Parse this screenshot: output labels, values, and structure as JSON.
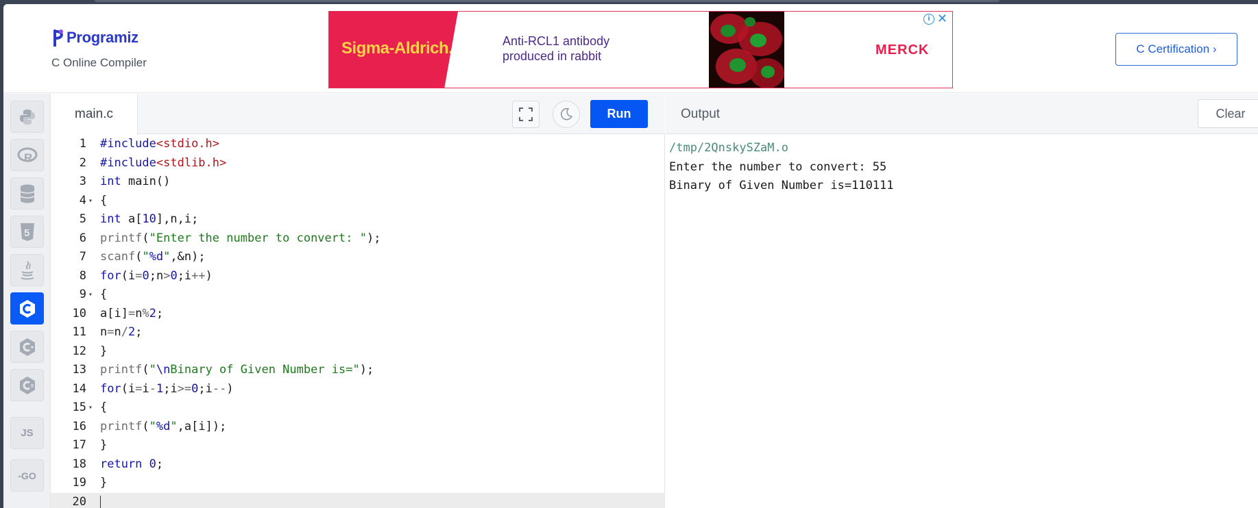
{
  "header": {
    "brand": "Programiz",
    "subtitle": "C Online Compiler",
    "certification_button": "C Certification ›"
  },
  "ad": {
    "advertiser": "Sigma-Aldrich.",
    "line1": "Anti-RCL1 antibody",
    "line2": "produced in rabbit",
    "brand2": "MERCK",
    "info_icon": "info-icon",
    "close_icon": "close-icon",
    "colors": {
      "accent": "#e8204e",
      "text": "#4b2a8a",
      "logo_text": "#ffd24a"
    }
  },
  "sidebar": {
    "languages": [
      {
        "name": "python",
        "label": "",
        "icon": "python-icon"
      },
      {
        "name": "r",
        "label": "R",
        "icon": "r-icon"
      },
      {
        "name": "sql",
        "label": "",
        "icon": "database-icon"
      },
      {
        "name": "html",
        "label": "5",
        "icon": "html5-icon"
      },
      {
        "name": "java",
        "label": "",
        "icon": "java-icon"
      },
      {
        "name": "c",
        "label": "C",
        "icon": "c-icon",
        "active": true
      },
      {
        "name": "cpp",
        "label": "C",
        "icon": "cpp-icon"
      },
      {
        "name": "csharp",
        "label": "C",
        "icon": "csharp-icon"
      },
      {
        "name": "js",
        "label": "JS",
        "icon": "js-icon"
      },
      {
        "name": "go",
        "label": "GO",
        "icon": "go-icon"
      }
    ]
  },
  "editor": {
    "filename": "main.c",
    "run_label": "Run",
    "fullscreen_icon": "fullscreen-icon",
    "theme_icon": "moon-icon",
    "lines": [
      "#include<stdio.h>",
      "#include<stdlib.h>",
      "int main()",
      "{",
      "int a[10],n,i;",
      "printf(\"Enter the number to convert: \");",
      "scanf(\"%d\",&n);",
      "for(i=0;n>0;i++)",
      "{",
      "a[i]=n%2;",
      "n=n/2;",
      "}",
      "printf(\"\\nBinary of Given Number is=\");",
      "for(i=i-1;i>=0;i--)",
      "{",
      "printf(\"%d\",a[i]);",
      "}",
      "return 0;",
      "}",
      ""
    ],
    "line_numbers": [
      "1",
      "2",
      "3",
      "4",
      "5",
      "6",
      "7",
      "8",
      "9",
      "10",
      "11",
      "12",
      "13",
      "14",
      "15",
      "16",
      "17",
      "18",
      "19",
      "20"
    ],
    "fold_lines": [
      4,
      9,
      15
    ],
    "current_line": 20
  },
  "output": {
    "label": "Output",
    "clear_label": "Clear",
    "lines": [
      "/tmp/2QnskySZaM.o",
      "Enter the number to convert: 55",
      "Binary of Given Number is=110111"
    ]
  },
  "colors": {
    "run_button": "#0556f3",
    "brand": "#2b39c8",
    "certification": "#1f5fd1"
  }
}
